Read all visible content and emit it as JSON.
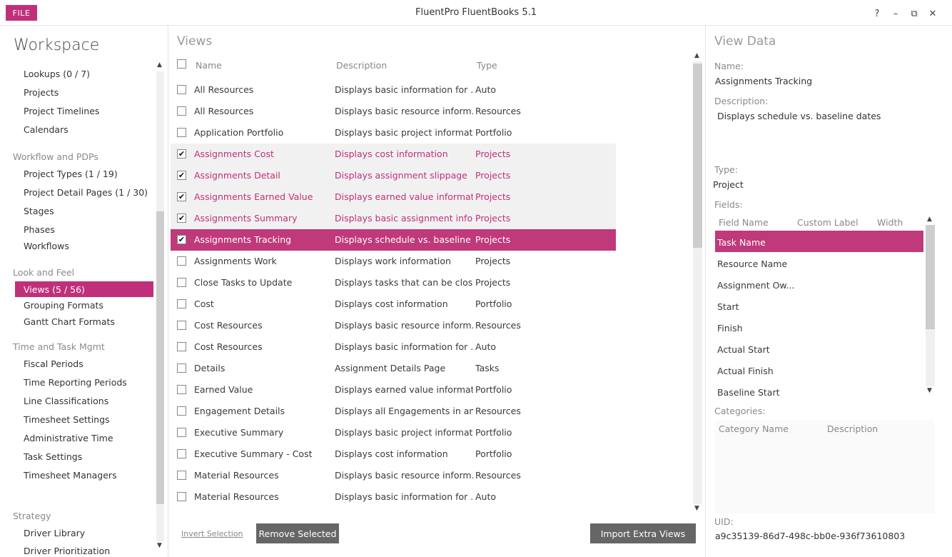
{
  "titlebar": {
    "file_label": "FILE",
    "app_title": "FluentPro FluentBooks 5.1",
    "help": "?",
    "minimize": "–",
    "restore": "⧉",
    "close": "✕"
  },
  "sidebar": {
    "title": "Workspace",
    "entries": [
      {
        "kind": "item",
        "label": "Lookups (0 / 7)"
      },
      {
        "kind": "item",
        "label": "Projects"
      },
      {
        "kind": "item",
        "label": "Project Timelines"
      },
      {
        "kind": "item",
        "label": "Calendars"
      },
      {
        "kind": "group",
        "label": "Workflow and PDPs"
      },
      {
        "kind": "item",
        "label": "Project Types (1 / 19)"
      },
      {
        "kind": "item",
        "label": "Project Detail Pages (1 / 30)"
      },
      {
        "kind": "item",
        "label": "Stages"
      },
      {
        "kind": "item",
        "label": "Phases"
      },
      {
        "kind": "item",
        "label": "Workflows"
      },
      {
        "kind": "group",
        "label": "Look and Feel"
      },
      {
        "kind": "item",
        "label": "Views (5 / 56)",
        "active": true
      },
      {
        "kind": "item",
        "label": "Grouping Formats"
      },
      {
        "kind": "item",
        "label": "Gantt Chart Formats"
      },
      {
        "kind": "group",
        "label": "Time and Task Mgmt"
      },
      {
        "kind": "item",
        "label": "Fiscal Periods"
      },
      {
        "kind": "item",
        "label": "Time Reporting Periods"
      },
      {
        "kind": "item",
        "label": "Line Classifications"
      },
      {
        "kind": "item",
        "label": "Timesheet Settings"
      },
      {
        "kind": "item",
        "label": "Administrative Time"
      },
      {
        "kind": "item",
        "label": "Task Settings"
      },
      {
        "kind": "item",
        "label": "Timesheet Managers"
      },
      {
        "kind": "group",
        "label": "Strategy"
      },
      {
        "kind": "item",
        "label": "Driver Library"
      },
      {
        "kind": "item",
        "label": "Driver Prioritization"
      }
    ]
  },
  "views": {
    "title": "Views",
    "columns": {
      "name": "Name",
      "description": "Description",
      "type": "Type"
    },
    "rows": [
      {
        "name": "All Resources",
        "description": "Displays basic information for ...",
        "type": "Auto",
        "checked": false
      },
      {
        "name": "All Resources",
        "description": "Displays basic resource inform...",
        "type": "Resources",
        "checked": false
      },
      {
        "name": "Application Portfolio",
        "description": "Displays basic project informat...",
        "type": "Portfolio",
        "checked": false
      },
      {
        "name": "Assignments Cost",
        "description": "Displays cost information",
        "type": "Projects",
        "checked": true
      },
      {
        "name": "Assignments Detail",
        "description": "Displays assignment slippage",
        "type": "Projects",
        "checked": true
      },
      {
        "name": "Assignments Earned Value",
        "description": "Displays earned value informat...",
        "type": "Projects",
        "checked": true
      },
      {
        "name": "Assignments Summary",
        "description": "Displays basic assignment info...",
        "type": "Projects",
        "checked": true
      },
      {
        "name": "Assignments Tracking",
        "description": "Displays schedule vs. baseline ...",
        "type": "Projects",
        "checked": true,
        "selected": true
      },
      {
        "name": "Assignments Work",
        "description": "Displays work information",
        "type": "Projects",
        "checked": false
      },
      {
        "name": "Close Tasks to Update",
        "description": "Displays tasks that can be clos...",
        "type": "Projects",
        "checked": false
      },
      {
        "name": "Cost",
        "description": "Displays cost information",
        "type": "Portfolio",
        "checked": false
      },
      {
        "name": "Cost Resources",
        "description": "Displays basic resource inform...",
        "type": "Resources",
        "checked": false
      },
      {
        "name": "Cost Resources",
        "description": "Displays basic information for ...",
        "type": "Auto",
        "checked": false
      },
      {
        "name": "Details",
        "description": "Assignment Details Page",
        "type": "Tasks",
        "checked": false
      },
      {
        "name": "Earned Value",
        "description": "Displays earned value informat...",
        "type": "Portfolio",
        "checked": false
      },
      {
        "name": "Engagement Details",
        "description": "Displays all Engagements in an...",
        "type": "Resources",
        "checked": false
      },
      {
        "name": "Executive Summary",
        "description": "Displays basic project informat...",
        "type": "Portfolio",
        "checked": false
      },
      {
        "name": "Executive Summary - Cost",
        "description": "Displays cost information",
        "type": "Portfolio",
        "checked": false
      },
      {
        "name": "Material Resources",
        "description": "Displays basic resource inform...",
        "type": "Resources",
        "checked": false
      },
      {
        "name": "Material Resources",
        "description": "Displays basic information for ...",
        "type": "Auto",
        "checked": false
      }
    ],
    "invert_selection": "Invert Selection",
    "remove_selected": "Remove Selected",
    "import_extra_views": "Import Extra Views"
  },
  "view_data": {
    "title": "View Data",
    "name_label": "Name:",
    "name_value": "Assignments Tracking",
    "description_label": "Description:",
    "description_value": "Displays schedule vs. baseline dates",
    "type_label": "Type:",
    "type_value": "Project",
    "fields_label": "Fields:",
    "fields_columns": {
      "field_name": "Field Name",
      "custom_label": "Custom Label",
      "width": "Width"
    },
    "fields": [
      "Task Name",
      "Resource Name",
      "Assignment Ow...",
      "Start",
      "Finish",
      "Actual Start",
      "Actual Finish",
      "Baseline Start"
    ],
    "categories_label": "Categories:",
    "categories_columns": {
      "category_name": "Category Name",
      "description": "Description"
    },
    "uid_label": "UID:",
    "uid_value": "a9c35139-86d7-498c-bb0e-936f73610803"
  },
  "colors": {
    "accent": "#c0307a",
    "button": "#666666"
  },
  "icons": {
    "checkbox_check": "check-mark",
    "scroll_up": "chevron-up-icon",
    "scroll_down": "chevron-down-icon"
  }
}
